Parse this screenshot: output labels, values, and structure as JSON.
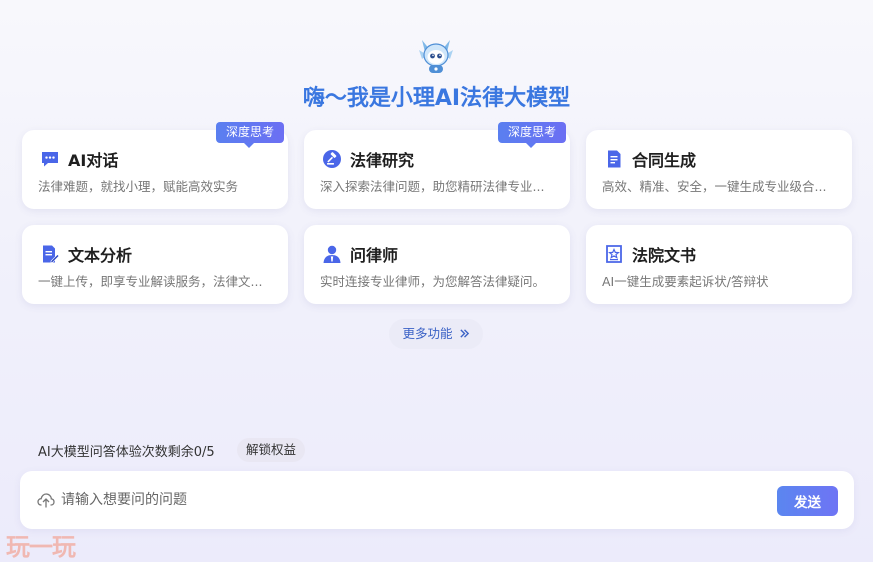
{
  "header": {
    "title": "嗨～我是小理AI法律大模型",
    "mascot_icon": "robot-mascot-icon"
  },
  "cards": [
    {
      "title": "AI对话",
      "desc": "法律难题，就找小理，赋能高效实务",
      "badge": "深度思考",
      "icon": "chat-bubble-icon"
    },
    {
      "title": "法律研究",
      "desc": "深入探索法律问题，助您精研法律专业...",
      "badge": "深度思考",
      "icon": "gavel-icon"
    },
    {
      "title": "合同生成",
      "desc": "高效、精准、安全，一键生成专业级合...",
      "badge": "",
      "icon": "document-icon"
    },
    {
      "title": "文本分析",
      "desc": "一键上传，即享专业解读服务，法律文...",
      "badge": "",
      "icon": "edit-document-icon"
    },
    {
      "title": "问律师",
      "desc": "实时连接专业律师，为您解答法律疑问。",
      "badge": "",
      "icon": "lawyer-icon"
    },
    {
      "title": "法院文书",
      "desc": "AI一键生成要素起诉状/答辩状",
      "badge": "",
      "icon": "court-document-icon"
    }
  ],
  "more": {
    "label": "更多功能"
  },
  "quota": {
    "text": "AI大模型问答体验次数剩余0/5",
    "unlock_label": "解锁权益"
  },
  "input": {
    "placeholder": "请输入想要问的问题",
    "value": "",
    "send_label": "发送"
  },
  "watermark": {
    "text": "玩一玩"
  },
  "colors": {
    "accent": "#3a77e0",
    "icon_blue": "#4a66e8",
    "badge": "#5f7af1",
    "background": "#f1f1fb"
  }
}
